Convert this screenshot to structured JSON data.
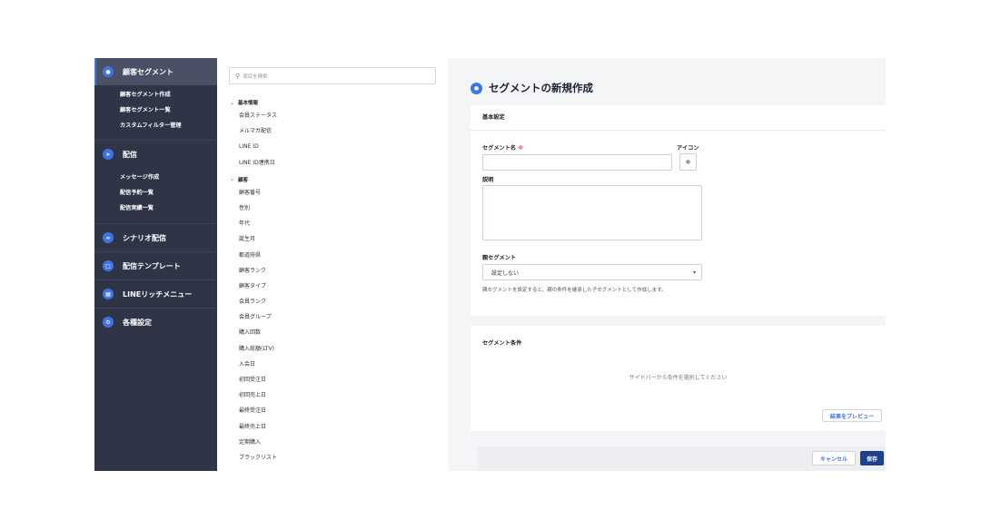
{
  "sidebar": {
    "groups": [
      {
        "label": "顧客セグメント",
        "icon": "people-icon",
        "items": [
          "顧客セグメント作成",
          "顧客セグメント一覧",
          "カスタムフィルター管理"
        ]
      },
      {
        "label": "配信",
        "icon": "send-icon",
        "items": [
          "メッセージ作成",
          "配信予約一覧",
          "配信実績一覧"
        ]
      },
      {
        "label": "シナリオ配信",
        "icon": "scenario-icon",
        "items": []
      },
      {
        "label": "配信テンプレート",
        "icon": "document-icon",
        "items": []
      },
      {
        "label": "LINEリッチメニュー",
        "icon": "grid-icon",
        "items": []
      },
      {
        "label": "各種設定",
        "icon": "gear-icon",
        "items": []
      }
    ]
  },
  "fields": {
    "search_placeholder": "項目を検索",
    "categories": [
      {
        "label": "基本情報",
        "items": [
          "会員ステータス",
          "メルマガ配信",
          "LINE ID",
          "LINE ID連携日"
        ]
      },
      {
        "label": "顧客",
        "items": [
          "顧客番号",
          "性別",
          "年代",
          "誕生月",
          "都道府県",
          "顧客ランク",
          "顧客タイプ",
          "会員ランク",
          "会員グループ",
          "購入回数",
          "購入総額(LTV)",
          "入会日",
          "初回受注日",
          "初回売上日",
          "最終受注日",
          "最終売上日",
          "定期購入",
          "ブラックリスト"
        ]
      }
    ]
  },
  "main": {
    "title": "セグメントの新規作成",
    "basic": {
      "heading": "基本設定",
      "name_label": "セグメント名",
      "required_mark": "※",
      "icon_label": "アイコン",
      "description_label": "説明",
      "parent_label": "親セグメント",
      "parent_value": "設定しない",
      "parent_help": "親セグメントを設定すると、親の条件を継承した子セグメントとして作成します。"
    },
    "conditions": {
      "heading": "セグメント条件",
      "empty_message": "サイドバーから条件を選択してください",
      "preview_button": "結果をプレビュー"
    },
    "footer": {
      "cancel": "キャンセル",
      "save": "保存"
    }
  }
}
